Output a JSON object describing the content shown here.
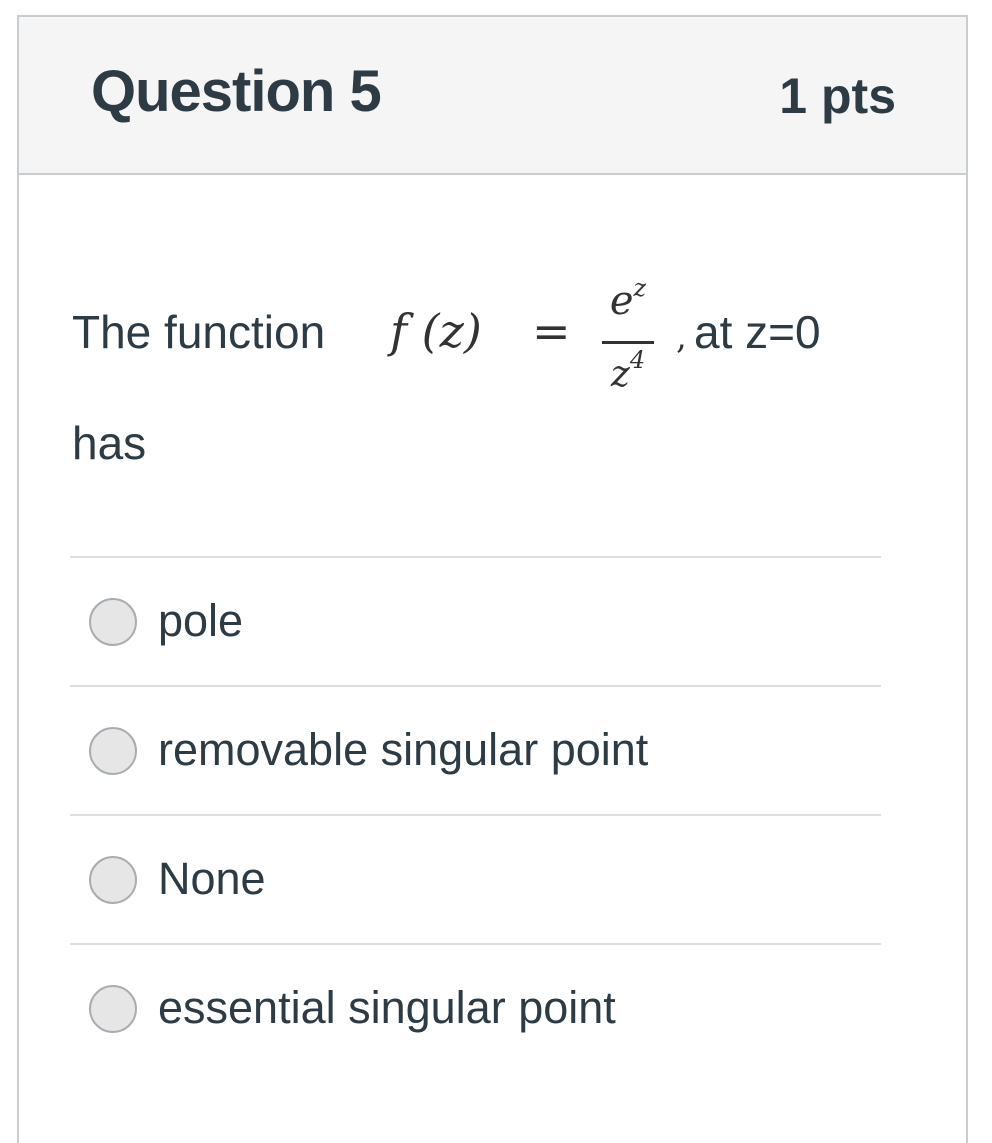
{
  "question": {
    "title": "Question 5",
    "points": "1 pts",
    "text_prefix": "The function",
    "formula": {
      "lhs": "f (z)",
      "equals": "=",
      "numerator_base": "e",
      "numerator_exp": "z",
      "denominator_base": "z",
      "denominator_exp": "4",
      "comma": ","
    },
    "text_suffix": "at z=0",
    "text_line2": "has"
  },
  "answers": [
    {
      "label": "pole",
      "selected": false
    },
    {
      "label": "removable singular point",
      "selected": false
    },
    {
      "label": "None",
      "selected": false
    },
    {
      "label": "essential singular point",
      "selected": false
    }
  ],
  "colors": {
    "text": "#2d3b45",
    "header_bg": "#f5f5f5",
    "border": "#c7cdd1",
    "divider": "#dcdfe2",
    "radio_fill": "#e6e6e6"
  }
}
